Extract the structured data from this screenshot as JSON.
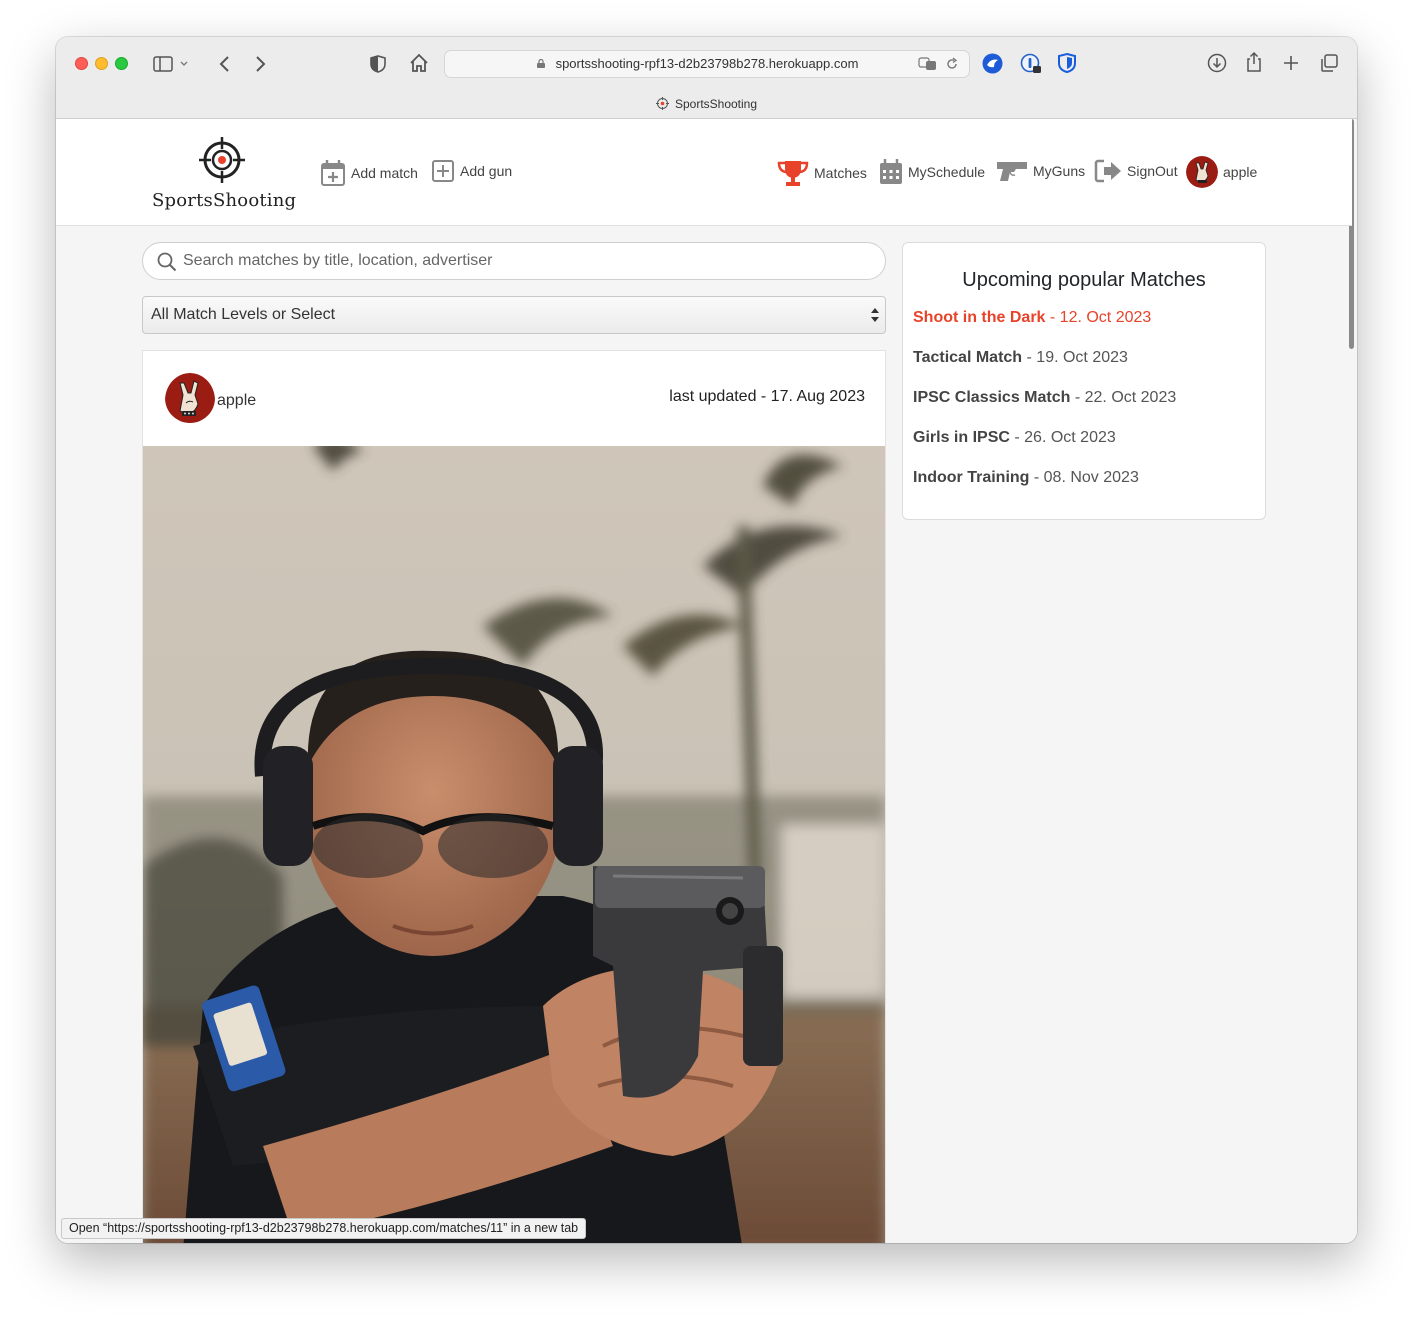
{
  "browser": {
    "url": "sportsshooting-rpf13-d2b23798b278.herokuapp.com",
    "tab_title": "SportsShooting"
  },
  "navbar": {
    "brand": "SportsShooting",
    "add_match": "Add match",
    "add_gun": "Add gun",
    "matches": "Matches",
    "my_schedule": "MySchedule",
    "my_guns": "MyGuns",
    "sign_out": "SignOut",
    "username": "apple"
  },
  "search": {
    "placeholder": "Search matches by title, location, advertiser"
  },
  "filter": {
    "selected": "All Match Levels or Select"
  },
  "card": {
    "author": "apple",
    "updated": "last updated - 17. Aug 2023"
  },
  "sidebar": {
    "title": "Upcoming popular Matches",
    "matches": [
      {
        "name": "Shoot in the Dark",
        "date": " - 12. Oct 2023"
      },
      {
        "name": "Tactical Match",
        "date": " - 19. Oct 2023"
      },
      {
        "name": "IPSC Classics Match",
        "date": " - 22. Oct 2023"
      },
      {
        "name": "Girls in IPSC",
        "date": " - 26. Oct 2023"
      },
      {
        "name": "Indoor Training",
        "date": " - 08. Nov 2023"
      }
    ]
  },
  "status_bar": {
    "text": "Open “https://sportsshooting-rpf13-d2b23798b278.herokuapp.com/matches/11” in a new tab"
  },
  "colors": {
    "accent": "#e8432a",
    "avatar_bg": "#9b1c12"
  }
}
